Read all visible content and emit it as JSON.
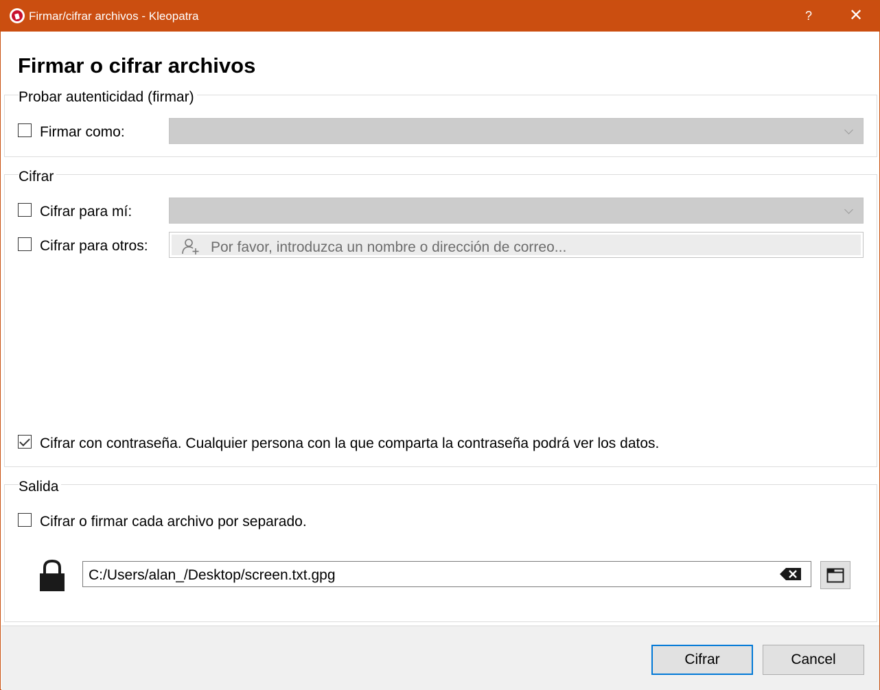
{
  "window": {
    "title": "Firmar/cifrar archivos - Kleopatra",
    "help_label": "?",
    "close_label": "✕",
    "accent": "#cb4e10"
  },
  "heading": "Firmar o cifrar archivos",
  "sign_group": {
    "title": "Probar autenticidad (firmar)",
    "sign_as": {
      "label": "Firmar como:",
      "checked": false,
      "value": ""
    }
  },
  "encrypt_group": {
    "title": "Cifrar",
    "encrypt_for_me": {
      "label": "Cifrar para mí:",
      "checked": false,
      "value": ""
    },
    "encrypt_for_others": {
      "label": "Cifrar para otros:",
      "checked": false,
      "placeholder": "Por favor, introduzca un nombre o dirección de correo...",
      "icon": "add-person-icon"
    },
    "password": {
      "label": "Cifrar con contraseña. Cualquier persona con la que comparta la contraseña podrá ver los datos.",
      "checked": true
    }
  },
  "output_group": {
    "title": "Salida",
    "separate_files": {
      "label": "Cifrar o firmar cada archivo por separado.",
      "checked": false
    },
    "lock_icon": "lock-icon",
    "output_path": "C:/Users/alan_/Desktop/screen.txt.gpg",
    "clear_icon": "backspace-icon",
    "browse_icon": "folder-icon"
  },
  "buttons": {
    "encrypt": "Cifrar",
    "cancel": "Cancel"
  }
}
